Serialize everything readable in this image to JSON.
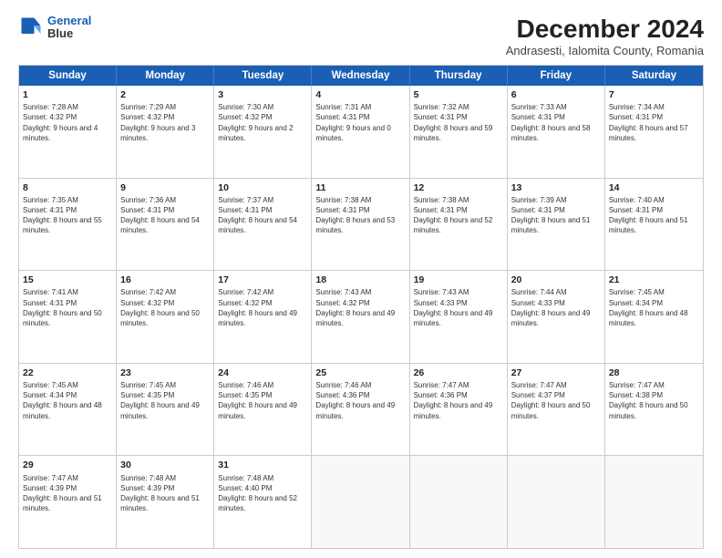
{
  "header": {
    "logo_line1": "General",
    "logo_line2": "Blue",
    "main_title": "December 2024",
    "subtitle": "Andrasesti, Ialomita County, Romania"
  },
  "weekdays": [
    "Sunday",
    "Monday",
    "Tuesday",
    "Wednesday",
    "Thursday",
    "Friday",
    "Saturday"
  ],
  "weeks": [
    [
      {
        "day": "1",
        "sunrise": "Sunrise: 7:28 AM",
        "sunset": "Sunset: 4:32 PM",
        "daylight": "Daylight: 9 hours and 4 minutes."
      },
      {
        "day": "2",
        "sunrise": "Sunrise: 7:29 AM",
        "sunset": "Sunset: 4:32 PM",
        "daylight": "Daylight: 9 hours and 3 minutes."
      },
      {
        "day": "3",
        "sunrise": "Sunrise: 7:30 AM",
        "sunset": "Sunset: 4:32 PM",
        "daylight": "Daylight: 9 hours and 2 minutes."
      },
      {
        "day": "4",
        "sunrise": "Sunrise: 7:31 AM",
        "sunset": "Sunset: 4:31 PM",
        "daylight": "Daylight: 9 hours and 0 minutes."
      },
      {
        "day": "5",
        "sunrise": "Sunrise: 7:32 AM",
        "sunset": "Sunset: 4:31 PM",
        "daylight": "Daylight: 8 hours and 59 minutes."
      },
      {
        "day": "6",
        "sunrise": "Sunrise: 7:33 AM",
        "sunset": "Sunset: 4:31 PM",
        "daylight": "Daylight: 8 hours and 58 minutes."
      },
      {
        "day": "7",
        "sunrise": "Sunrise: 7:34 AM",
        "sunset": "Sunset: 4:31 PM",
        "daylight": "Daylight: 8 hours and 57 minutes."
      }
    ],
    [
      {
        "day": "8",
        "sunrise": "Sunrise: 7:35 AM",
        "sunset": "Sunset: 4:31 PM",
        "daylight": "Daylight: 8 hours and 55 minutes."
      },
      {
        "day": "9",
        "sunrise": "Sunrise: 7:36 AM",
        "sunset": "Sunset: 4:31 PM",
        "daylight": "Daylight: 8 hours and 54 minutes."
      },
      {
        "day": "10",
        "sunrise": "Sunrise: 7:37 AM",
        "sunset": "Sunset: 4:31 PM",
        "daylight": "Daylight: 8 hours and 54 minutes."
      },
      {
        "day": "11",
        "sunrise": "Sunrise: 7:38 AM",
        "sunset": "Sunset: 4:31 PM",
        "daylight": "Daylight: 8 hours and 53 minutes."
      },
      {
        "day": "12",
        "sunrise": "Sunrise: 7:38 AM",
        "sunset": "Sunset: 4:31 PM",
        "daylight": "Daylight: 8 hours and 52 minutes."
      },
      {
        "day": "13",
        "sunrise": "Sunrise: 7:39 AM",
        "sunset": "Sunset: 4:31 PM",
        "daylight": "Daylight: 8 hours and 51 minutes."
      },
      {
        "day": "14",
        "sunrise": "Sunrise: 7:40 AM",
        "sunset": "Sunset: 4:31 PM",
        "daylight": "Daylight: 8 hours and 51 minutes."
      }
    ],
    [
      {
        "day": "15",
        "sunrise": "Sunrise: 7:41 AM",
        "sunset": "Sunset: 4:31 PM",
        "daylight": "Daylight: 8 hours and 50 minutes."
      },
      {
        "day": "16",
        "sunrise": "Sunrise: 7:42 AM",
        "sunset": "Sunset: 4:32 PM",
        "daylight": "Daylight: 8 hours and 50 minutes."
      },
      {
        "day": "17",
        "sunrise": "Sunrise: 7:42 AM",
        "sunset": "Sunset: 4:32 PM",
        "daylight": "Daylight: 8 hours and 49 minutes."
      },
      {
        "day": "18",
        "sunrise": "Sunrise: 7:43 AM",
        "sunset": "Sunset: 4:32 PM",
        "daylight": "Daylight: 8 hours and 49 minutes."
      },
      {
        "day": "19",
        "sunrise": "Sunrise: 7:43 AM",
        "sunset": "Sunset: 4:33 PM",
        "daylight": "Daylight: 8 hours and 49 minutes."
      },
      {
        "day": "20",
        "sunrise": "Sunrise: 7:44 AM",
        "sunset": "Sunset: 4:33 PM",
        "daylight": "Daylight: 8 hours and 49 minutes."
      },
      {
        "day": "21",
        "sunrise": "Sunrise: 7:45 AM",
        "sunset": "Sunset: 4:34 PM",
        "daylight": "Daylight: 8 hours and 48 minutes."
      }
    ],
    [
      {
        "day": "22",
        "sunrise": "Sunrise: 7:45 AM",
        "sunset": "Sunset: 4:34 PM",
        "daylight": "Daylight: 8 hours and 48 minutes."
      },
      {
        "day": "23",
        "sunrise": "Sunrise: 7:45 AM",
        "sunset": "Sunset: 4:35 PM",
        "daylight": "Daylight: 8 hours and 49 minutes."
      },
      {
        "day": "24",
        "sunrise": "Sunrise: 7:46 AM",
        "sunset": "Sunset: 4:35 PM",
        "daylight": "Daylight: 8 hours and 49 minutes."
      },
      {
        "day": "25",
        "sunrise": "Sunrise: 7:46 AM",
        "sunset": "Sunset: 4:36 PM",
        "daylight": "Daylight: 8 hours and 49 minutes."
      },
      {
        "day": "26",
        "sunrise": "Sunrise: 7:47 AM",
        "sunset": "Sunset: 4:36 PM",
        "daylight": "Daylight: 8 hours and 49 minutes."
      },
      {
        "day": "27",
        "sunrise": "Sunrise: 7:47 AM",
        "sunset": "Sunset: 4:37 PM",
        "daylight": "Daylight: 8 hours and 50 minutes."
      },
      {
        "day": "28",
        "sunrise": "Sunrise: 7:47 AM",
        "sunset": "Sunset: 4:38 PM",
        "daylight": "Daylight: 8 hours and 50 minutes."
      }
    ],
    [
      {
        "day": "29",
        "sunrise": "Sunrise: 7:47 AM",
        "sunset": "Sunset: 4:39 PM",
        "daylight": "Daylight: 8 hours and 51 minutes."
      },
      {
        "day": "30",
        "sunrise": "Sunrise: 7:48 AM",
        "sunset": "Sunset: 4:39 PM",
        "daylight": "Daylight: 8 hours and 51 minutes."
      },
      {
        "day": "31",
        "sunrise": "Sunrise: 7:48 AM",
        "sunset": "Sunset: 4:40 PM",
        "daylight": "Daylight: 8 hours and 52 minutes."
      },
      null,
      null,
      null,
      null
    ]
  ]
}
